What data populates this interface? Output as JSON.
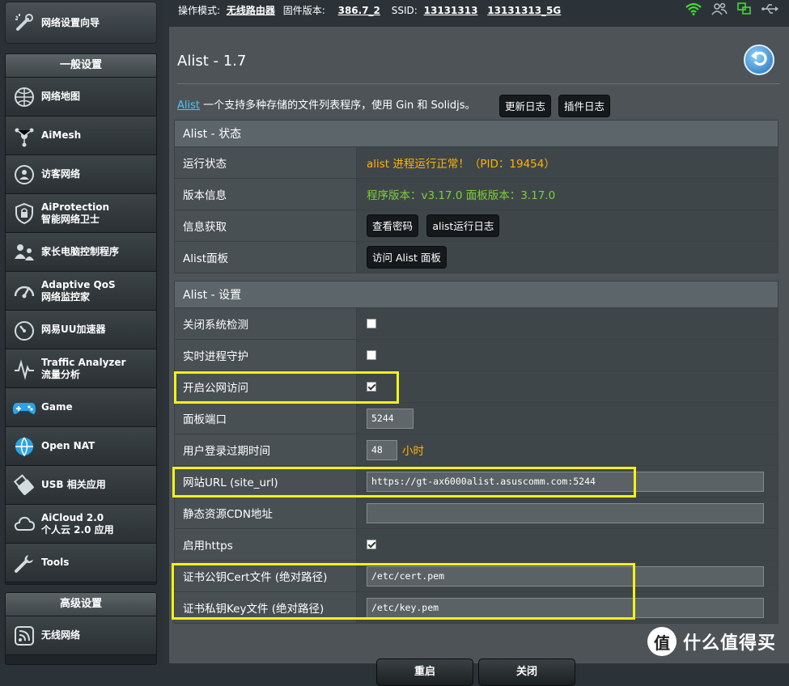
{
  "sidebar": {
    "wizard": {
      "label": "网络设置向导",
      "icon": "wizard-icon"
    },
    "general": {
      "header": "一般设置",
      "items": [
        {
          "label": "网络地图",
          "icon": "network-map-icon"
        },
        {
          "label": "AiMesh",
          "icon": "aimesh-icon"
        },
        {
          "label": "访客网络",
          "icon": "guest-network-icon"
        },
        {
          "label": "AiProtection\n智能网络卫士",
          "icon": "shield-icon"
        },
        {
          "label": "家长电脑控制程序",
          "icon": "parental-control-icon"
        },
        {
          "label": "Adaptive QoS\n网络监控家",
          "icon": "qos-gauge-icon"
        },
        {
          "label": "网易UU加速器",
          "icon": "speedometer-icon"
        },
        {
          "label": "Traffic Analyzer\n流量分析",
          "icon": "traffic-analyzer-icon"
        },
        {
          "label": "Game",
          "icon": "gamepad-icon"
        },
        {
          "label": "Open NAT",
          "icon": "globe-icon"
        },
        {
          "label": "USB 相关应用",
          "icon": "usb-icon"
        },
        {
          "label": "AiCloud 2.0\n个人云 2.0 应用",
          "icon": "cloud-icon"
        },
        {
          "label": "Tools",
          "icon": "wrench-icon"
        }
      ]
    },
    "advanced": {
      "header": "高级设置",
      "items": [
        {
          "label": "无线网络",
          "icon": "wireless-icon"
        }
      ]
    }
  },
  "topbar": {
    "mode_label": "操作模式:",
    "mode_value": "无线路由器",
    "firmware_label": "固件版本:",
    "firmware_value": "386.7_2",
    "ssid_label": "SSID:",
    "ssid_1": "13131313",
    "ssid_2": "13131313_5G",
    "icons": [
      "wifi-icon",
      "users-icon",
      "network-status-icon",
      "usb-status-icon"
    ]
  },
  "page": {
    "title": "Alist - 1.7",
    "desc_link": "Alist",
    "desc_text": " 一个支持多种存储的文件列表程序，使用 Gin 和 Solidjs。",
    "changelog_button": "更新日志",
    "plugin_log_button": "插件日志"
  },
  "status": {
    "header": "Alist - 状态",
    "run_label": "运行状态",
    "run_value": "alist 进程运行正常！（PID：19454）",
    "version_label": "版本信息",
    "version_value": "程序版本：v3.17.0  面板版本：3.17.0",
    "info_label": "信息获取",
    "view_password_button": "查看密码",
    "run_log_button": "alist运行日志",
    "panel_label": "Alist面板",
    "visit_panel_button": "访问 Alist 面板"
  },
  "settings": {
    "header": "Alist - 设置",
    "disable_check_label": "关闭系统检测",
    "disable_check_on": false,
    "watchdog_label": "实时进程守护",
    "watchdog_on": false,
    "public_access_label": "开启公网访问",
    "public_access_on": true,
    "port_label": "面板端口",
    "port_value": "5244",
    "expire_label": "用户登录过期时间",
    "expire_value": "48",
    "expire_unit": "小时",
    "site_url_label": "网站URL (site_url)",
    "site_url_value": "https://gt-ax6000alist.asuscomm.com:5244",
    "cdn_label": "静态资源CDN地址",
    "cdn_value": "",
    "https_label": "启用https",
    "https_on": true,
    "cert_label": "证书公钥Cert文件 (绝对路径)",
    "cert_value": "/etc/cert.pem",
    "key_label": "证书私钥Key文件 (绝对路径)",
    "key_value": "/etc/key.pem"
  },
  "actions": {
    "restart_button": "重启",
    "close_button": "关闭"
  },
  "watermark": {
    "logo": "值",
    "text": "什么值得买"
  },
  "colors": {
    "accent_orange": "#ffb300",
    "link_blue": "#48c7ff",
    "highlight_yellow": "#f3f313",
    "wifi_green": "#3ddc2f"
  }
}
